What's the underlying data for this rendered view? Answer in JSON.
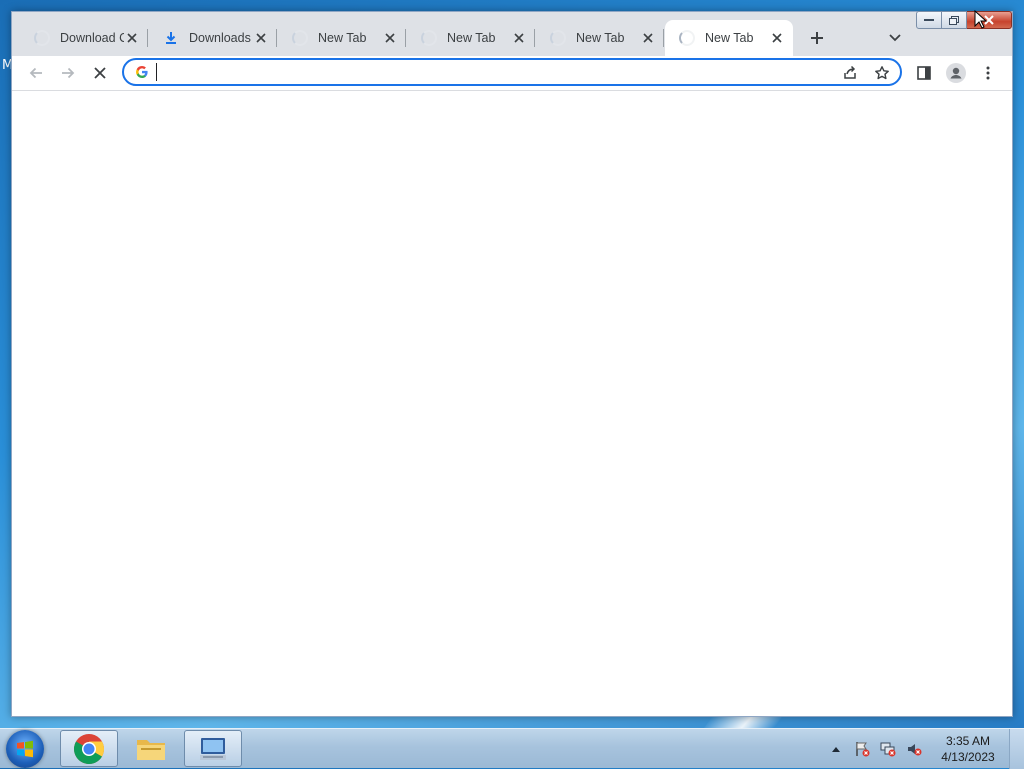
{
  "desktop": {
    "edge_glyph": "M"
  },
  "browser": {
    "tabs": [
      {
        "title": "Download C",
        "favicon": "loading-spinner-icon",
        "active": false
      },
      {
        "title": "Downloads",
        "favicon": "download-icon",
        "active": false
      },
      {
        "title": "New Tab",
        "favicon": "loading-spinner-icon",
        "active": false
      },
      {
        "title": "New Tab",
        "favicon": "loading-spinner-icon",
        "active": false
      },
      {
        "title": "New Tab",
        "favicon": "loading-spinner-icon",
        "active": false
      },
      {
        "title": "New Tab",
        "favicon": "loading-spinner-icon",
        "active": true
      }
    ],
    "omnibox": {
      "value": "",
      "placeholder": ""
    },
    "colors": {
      "accent": "#1a73e8",
      "tabstrip": "#dee1e6"
    }
  },
  "taskbar": {
    "clock": {
      "time": "3:35 AM",
      "date": "4/13/2023"
    },
    "items": [
      "chrome-icon",
      "file-explorer-icon",
      "remote-desktop-icon"
    ]
  }
}
